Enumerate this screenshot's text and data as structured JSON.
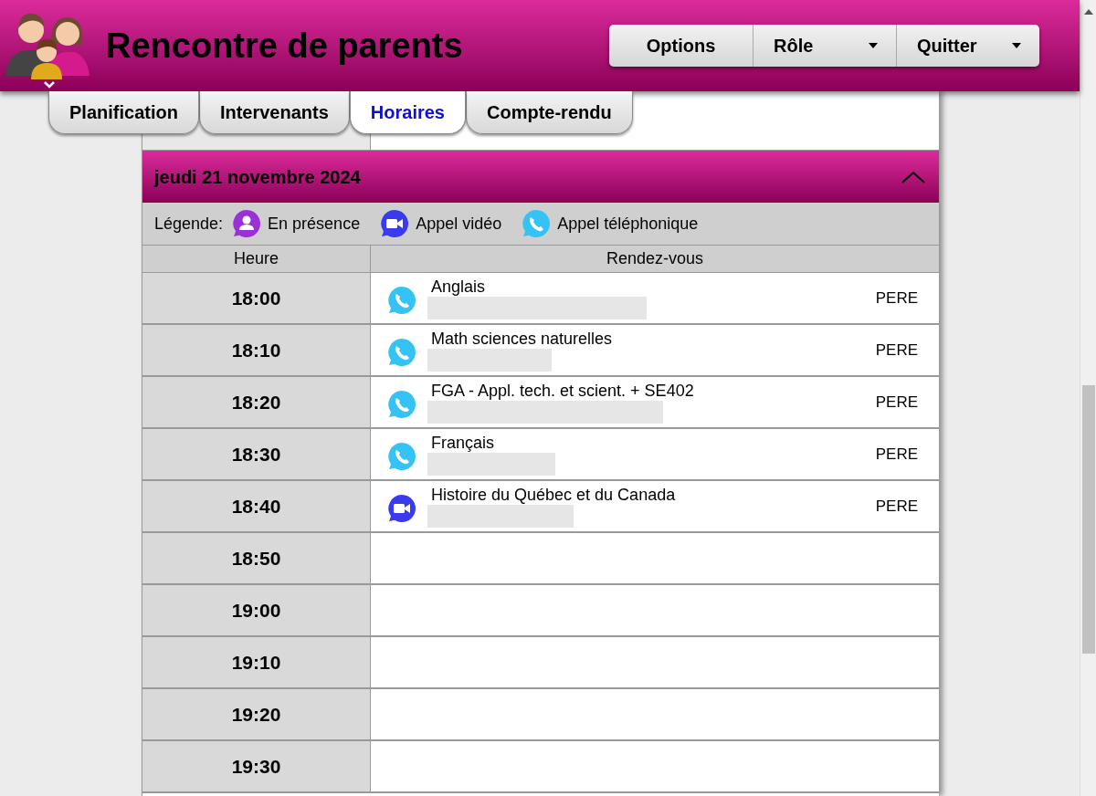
{
  "header": {
    "title": "Rencontre de parents",
    "buttons": [
      {
        "label": "Options",
        "dropdown": false
      },
      {
        "label": "Rôle",
        "dropdown": true
      },
      {
        "label": "Quitter",
        "dropdown": true
      }
    ]
  },
  "tabs": [
    {
      "label": "Planification",
      "selected": false
    },
    {
      "label": "Intervenants",
      "selected": false
    },
    {
      "label": "Horaires",
      "selected": true
    },
    {
      "label": "Compte-rendu",
      "selected": false
    }
  ],
  "day": {
    "title": "jeudi 21 novembre 2024",
    "expanded": true,
    "legend": {
      "label": "Légende:",
      "items": [
        {
          "kind": "in_person",
          "label": "En présence"
        },
        {
          "kind": "video",
          "label": "Appel vidéo"
        },
        {
          "kind": "phone",
          "label": "Appel téléphonique"
        }
      ]
    },
    "columns": [
      "Heure",
      "Rendez-vous"
    ],
    "rows": [
      {
        "time": "18:00",
        "kind": "phone",
        "subject": "Anglais",
        "redacted": true,
        "who": "PERE"
      },
      {
        "time": "18:10",
        "kind": "phone",
        "subject": "Math sciences naturelles",
        "redacted": true,
        "who": "PERE"
      },
      {
        "time": "18:20",
        "kind": "phone",
        "subject": "FGA - Appl. tech. et scient. + SE402",
        "redacted": true,
        "who": "PERE"
      },
      {
        "time": "18:30",
        "kind": "phone",
        "subject": "Français",
        "redacted": true,
        "who": "PERE"
      },
      {
        "time": "18:40",
        "kind": "video",
        "subject": "Histoire du Québec et du Canada",
        "redacted": true,
        "who": "PERE"
      },
      {
        "time": "18:50"
      },
      {
        "time": "19:00"
      },
      {
        "time": "19:10"
      },
      {
        "time": "19:20"
      },
      {
        "time": "19:30"
      }
    ]
  }
}
